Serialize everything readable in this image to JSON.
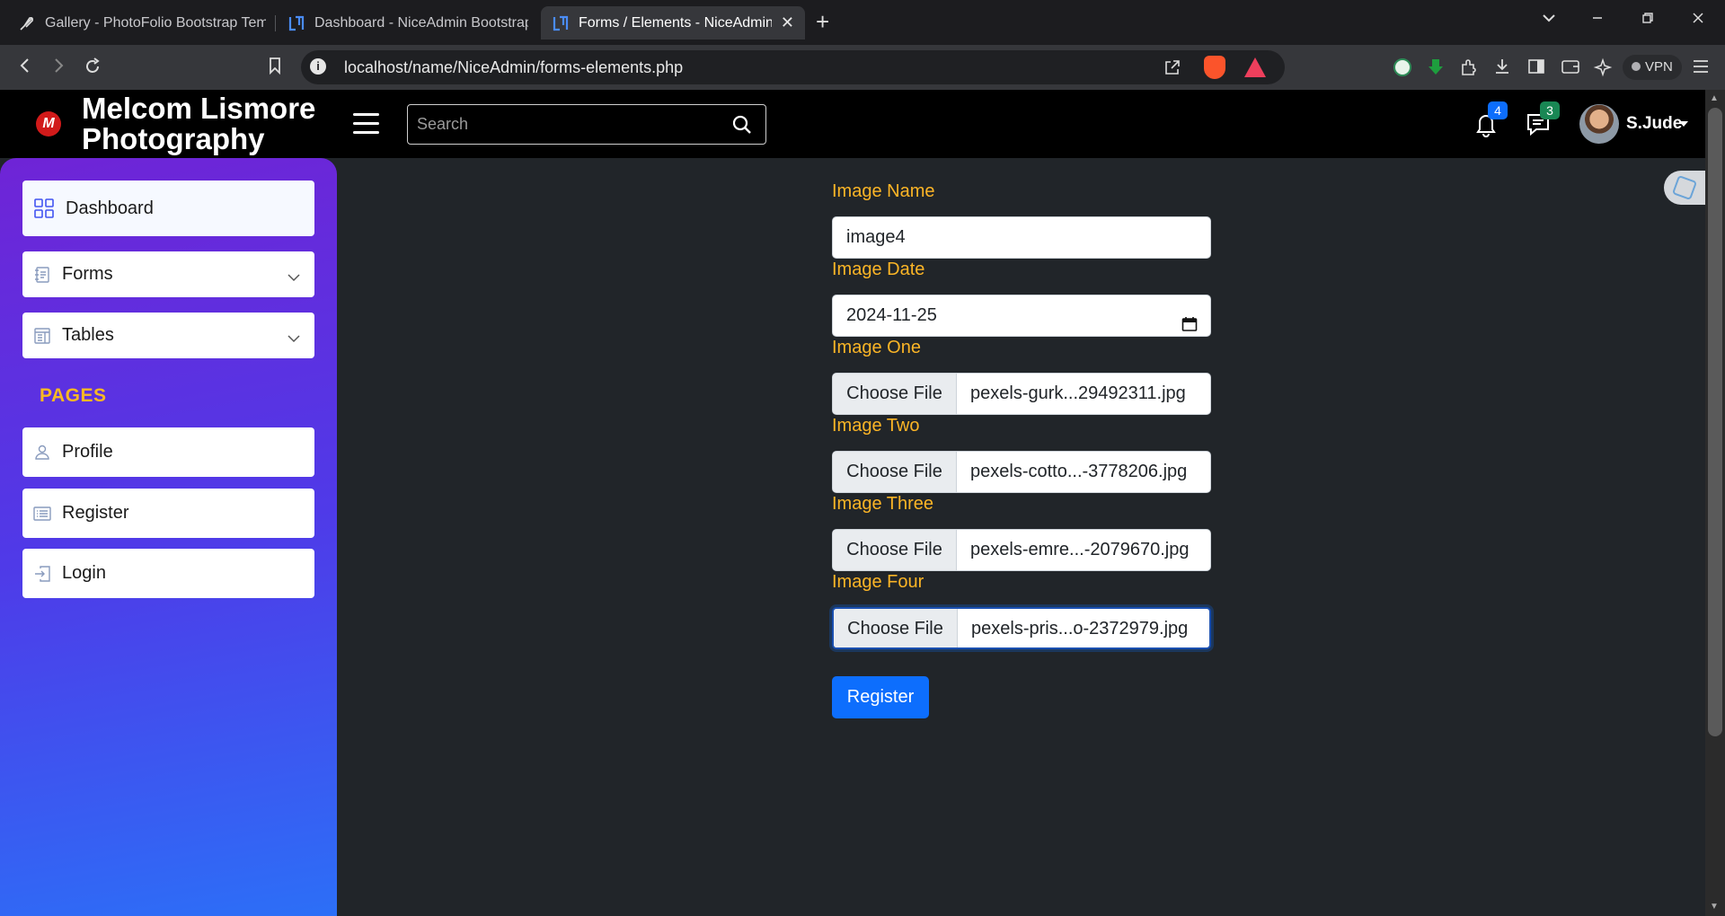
{
  "browser": {
    "tabs": [
      {
        "title": "Gallery - PhotoFolio Bootstrap Temp",
        "active": false
      },
      {
        "title": "Dashboard - NiceAdmin Bootstrap T",
        "active": false
      },
      {
        "title": "Forms / Elements - NiceAdmin",
        "active": true
      }
    ],
    "url": "localhost/name/NiceAdmin/forms-elements.php",
    "vpn_label": "VPN"
  },
  "header": {
    "logo_letter": "M",
    "brand_line1": "Melcom Lismore",
    "brand_line2": "Photography",
    "search_placeholder": "Search",
    "notifications_count": "4",
    "messages_count": "3",
    "user_name": "S.Jude"
  },
  "sidebar": {
    "items": [
      {
        "label": "Dashboard",
        "icon": "grid-icon"
      },
      {
        "label": "Forms",
        "icon": "journal-text-icon"
      },
      {
        "label": "Tables",
        "icon": "layout-text-window-icon"
      }
    ],
    "pages_heading": "PAGES",
    "pages": [
      {
        "label": "Profile",
        "icon": "person-icon"
      },
      {
        "label": "Register",
        "icon": "card-list-icon"
      },
      {
        "label": "Login",
        "icon": "box-arrow-in-right-icon"
      }
    ]
  },
  "form": {
    "image_name_label": "Image Name",
    "image_name_value": "image4",
    "image_date_label": "Image Date",
    "image_date_value": "2024-11-25",
    "file_button_label": "Choose File",
    "files": [
      {
        "label": "Image One",
        "filename": "pexels-gurk...29492311.jpg"
      },
      {
        "label": "Image Two",
        "filename": "pexels-cotto...-3778206.jpg"
      },
      {
        "label": "Image Three",
        "filename": "pexels-emre...-2079670.jpg"
      },
      {
        "label": "Image Four",
        "filename": "pexels-pris...o-2372979.jpg"
      }
    ],
    "submit_label": "Register"
  },
  "colors": {
    "label": "#fcb526",
    "primary": "#0d6efd",
    "badge_notifications": "#0d6efd",
    "badge_messages": "#198754",
    "sidebar_top": "#6f24d6",
    "sidebar_bottom": "#2c6ff7"
  }
}
